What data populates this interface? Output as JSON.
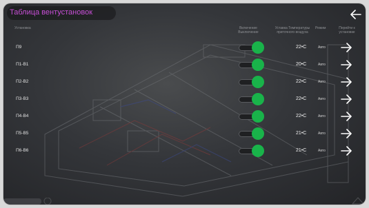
{
  "header": {
    "title": "Таблица вентустановок"
  },
  "columns": {
    "name": "Установка",
    "power": "Включение Выключение",
    "setpoint": "Уставка Температуры приточного воздуха",
    "mode": "Режим",
    "open": "Перейти к установке"
  },
  "units": [
    {
      "name": "П9",
      "enabled": true,
      "setpoint": "22•C",
      "mode": "Авто"
    },
    {
      "name": "П1-В1",
      "enabled": true,
      "setpoint": "20•C",
      "mode": "Авто"
    },
    {
      "name": "П2-В2",
      "enabled": true,
      "setpoint": "22•C",
      "mode": "Авто"
    },
    {
      "name": "П3-В3",
      "enabled": true,
      "setpoint": "22•C",
      "mode": "Авто"
    },
    {
      "name": "П4-В4",
      "enabled": true,
      "setpoint": "22•C",
      "mode": "Авто"
    },
    {
      "name": "П5-В5",
      "enabled": true,
      "setpoint": "21•C",
      "mode": "Авто"
    },
    {
      "name": "П6-В6",
      "enabled": true,
      "setpoint": "21•C",
      "mode": "Авто"
    }
  ],
  "colors": {
    "title": "#c74fd6",
    "toggle_on": "#19b34a",
    "text": "#e3e3e3"
  },
  "icons": {
    "back": "arrow-left-icon",
    "open": "arrow-right-icon",
    "toggle": "toggle-switch"
  }
}
